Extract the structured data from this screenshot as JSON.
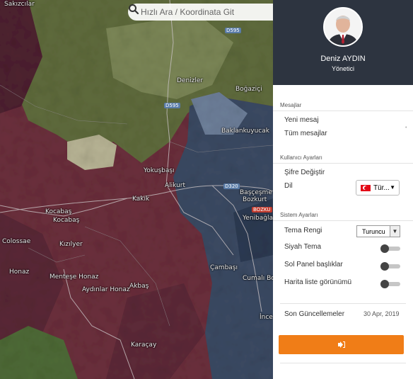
{
  "search": {
    "placeholder": "Hızlı Ara / Koordinata Git"
  },
  "map": {
    "places": [
      "Sakızcılar",
      "Denizler",
      "Boğaziçi",
      "Baklankuyucak",
      "Yokuşbaşı",
      "Alikurt",
      "Başçeşme",
      "Bozkurt",
      "Kocabaş",
      "Kakık",
      "Yenibağlar",
      "Colossae",
      "Kızılyer",
      "Honaz",
      "Menteşe Honaz",
      "Aydınlar Honaz",
      "Akbaş",
      "Çambaşı",
      "Cumalı Bozkurt",
      "İnce",
      "Karaçay"
    ],
    "roads": [
      "D595",
      "D595",
      "D320",
      "BOZKU"
    ]
  },
  "profile": {
    "name": "Deniz AYDIN",
    "role": "Yönetici"
  },
  "messages": {
    "title": "Mesajlar",
    "new": "Yeni mesaj",
    "all": "Tüm mesajlar"
  },
  "user_settings": {
    "title": "Kullanıcı Ayarları",
    "change_password": "Şifre Değiştir",
    "language_label": "Dil",
    "language_value": "Tür..."
  },
  "system_settings": {
    "title": "Sistem Ayarları",
    "theme_color_label": "Tema Rengi",
    "theme_color_value": "Turuncu",
    "dark_theme_label": "Siyah Tema",
    "left_panel_headers_label": "Sol Panel başlıklar",
    "map_list_view_label": "Harita liste görünümü"
  },
  "updates": {
    "label": "Son Güncellemeler",
    "date": "30 Apr, 2019"
  },
  "colors": {
    "accent": "#f07d17",
    "header_bg": "#2d3440"
  }
}
